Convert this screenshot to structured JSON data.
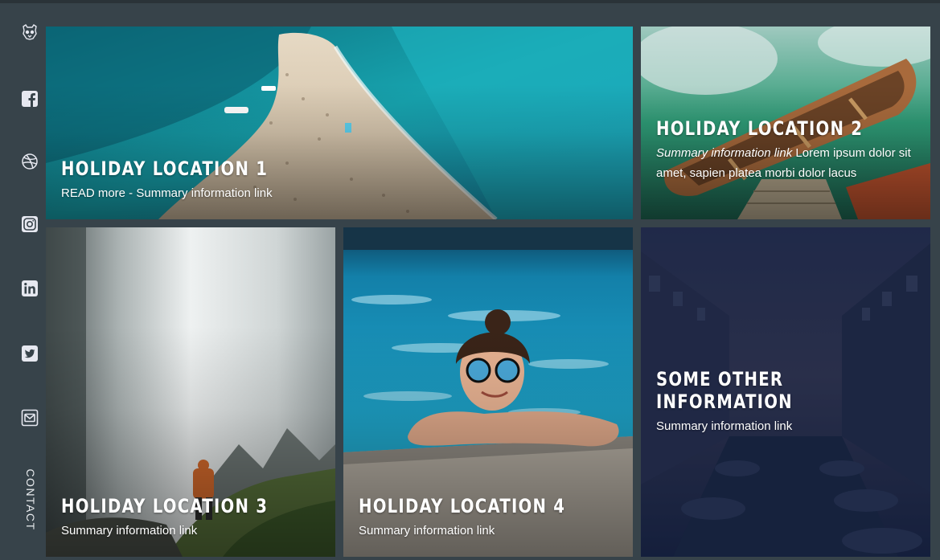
{
  "sidebar": {
    "items": [
      {
        "name": "logo-icon"
      },
      {
        "name": "facebook-icon"
      },
      {
        "name": "dribbble-icon"
      },
      {
        "name": "instagram-icon"
      },
      {
        "name": "linkedin-icon"
      },
      {
        "name": "twitter-icon"
      },
      {
        "name": "mail-icon"
      }
    ],
    "contact_label": "CONTACT"
  },
  "tiles": [
    {
      "title": "HOLIDAY LOCATION 1",
      "summary": "READ more - Summary information link"
    },
    {
      "title": "HOLIDAY LOCATION 2",
      "summary_link": "Summary information link",
      "summary_text": " Lorem ipsum dolor sit amet, sapien platea morbi dolor lacus"
    },
    {
      "title": "HOLIDAY LOCATION 3",
      "summary": "Summary information link"
    },
    {
      "title": "HOLIDAY LOCATION 4",
      "summary": "Summary information link"
    },
    {
      "title": "SOME OTHER INFORMATION",
      "summary": "Summary information link"
    }
  ],
  "colors": {
    "background": "#37434a",
    "icon": "#e6e8f0",
    "text": "#ffffff"
  }
}
